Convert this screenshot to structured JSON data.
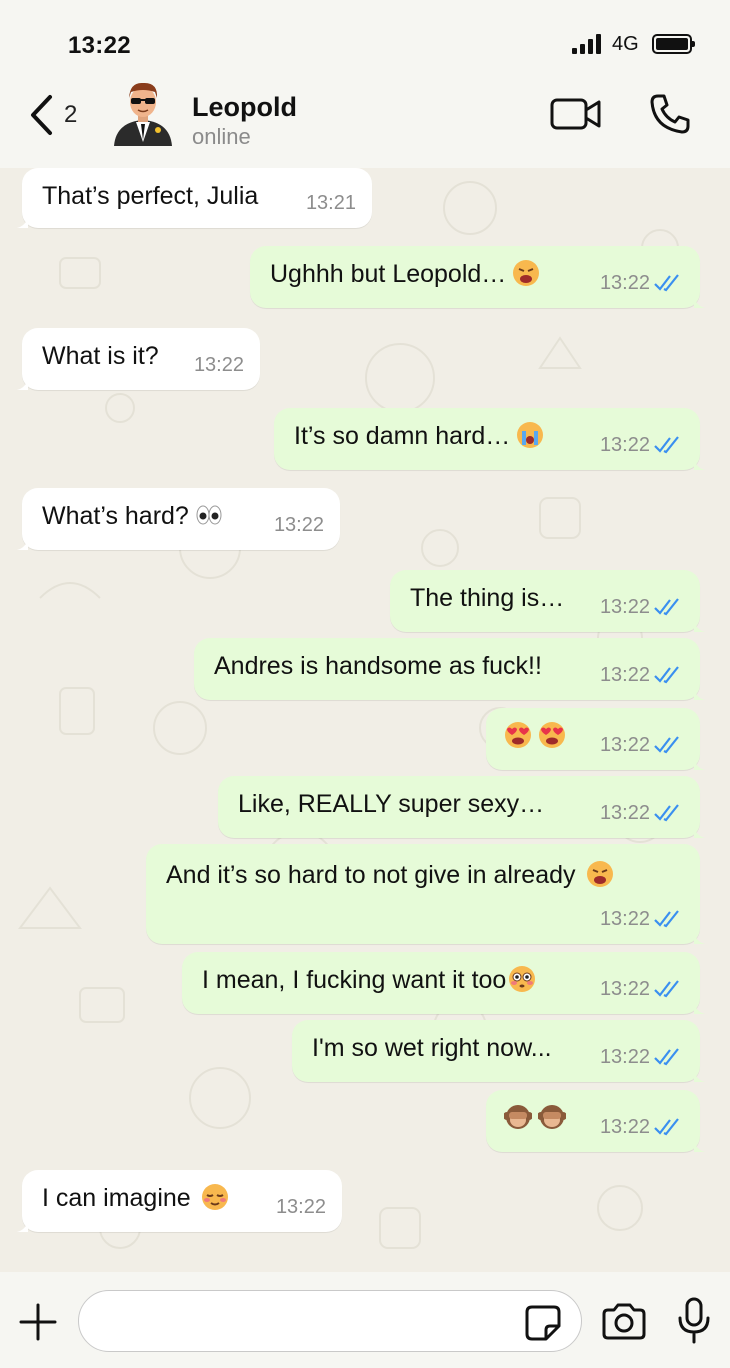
{
  "status_bar": {
    "time": "13:22",
    "network": "4G"
  },
  "header": {
    "back_count": "2",
    "contact_name": "Leopold",
    "contact_status": "online"
  },
  "messages": [
    {
      "side": "in",
      "text": "That’s perfect, Julia",
      "time": "13:21"
    },
    {
      "side": "out",
      "text": "Ughhh but Leopold…",
      "emoji": "weary-face",
      "time": "13:22"
    },
    {
      "side": "in",
      "text": "What is it?",
      "time": "13:22"
    },
    {
      "side": "out",
      "text": "It’s so damn hard…",
      "emoji": "crying-face",
      "time": "13:22"
    },
    {
      "side": "in",
      "text": "What’s hard?",
      "emoji": "eyes",
      "time": "13:22"
    },
    {
      "side": "out",
      "text": "The thing is…",
      "time": "13:22"
    },
    {
      "side": "out",
      "text": "Andres is handsome as fuck!!",
      "time": "13:22"
    },
    {
      "side": "out",
      "text": "",
      "emoji": "heart-eyes x2",
      "time": "13:22"
    },
    {
      "side": "out",
      "text": "Like, REALLY super sexy…",
      "time": "13:22"
    },
    {
      "side": "out",
      "text": "And it’s so hard to not give in already",
      "emoji": "weary-face",
      "time": "13:22"
    },
    {
      "side": "out",
      "text": "I mean, I fucking want it too",
      "emoji": "flushed-face",
      "time": "13:22"
    },
    {
      "side": "out",
      "text": "I'm so wet right now...",
      "time": "13:22"
    },
    {
      "side": "out",
      "text": "",
      "emoji": "see-no-evil-monkey x2",
      "time": "13:22"
    },
    {
      "side": "in",
      "text": "I can imagine",
      "emoji": "relieved-face",
      "time": "13:22"
    }
  ],
  "input": {
    "placeholder": ""
  },
  "colors": {
    "incoming": "#ffffff",
    "outgoing": "#e6fbd8",
    "read_ticks": "#3a8ff0",
    "chat_bg": "#f1eee6"
  }
}
